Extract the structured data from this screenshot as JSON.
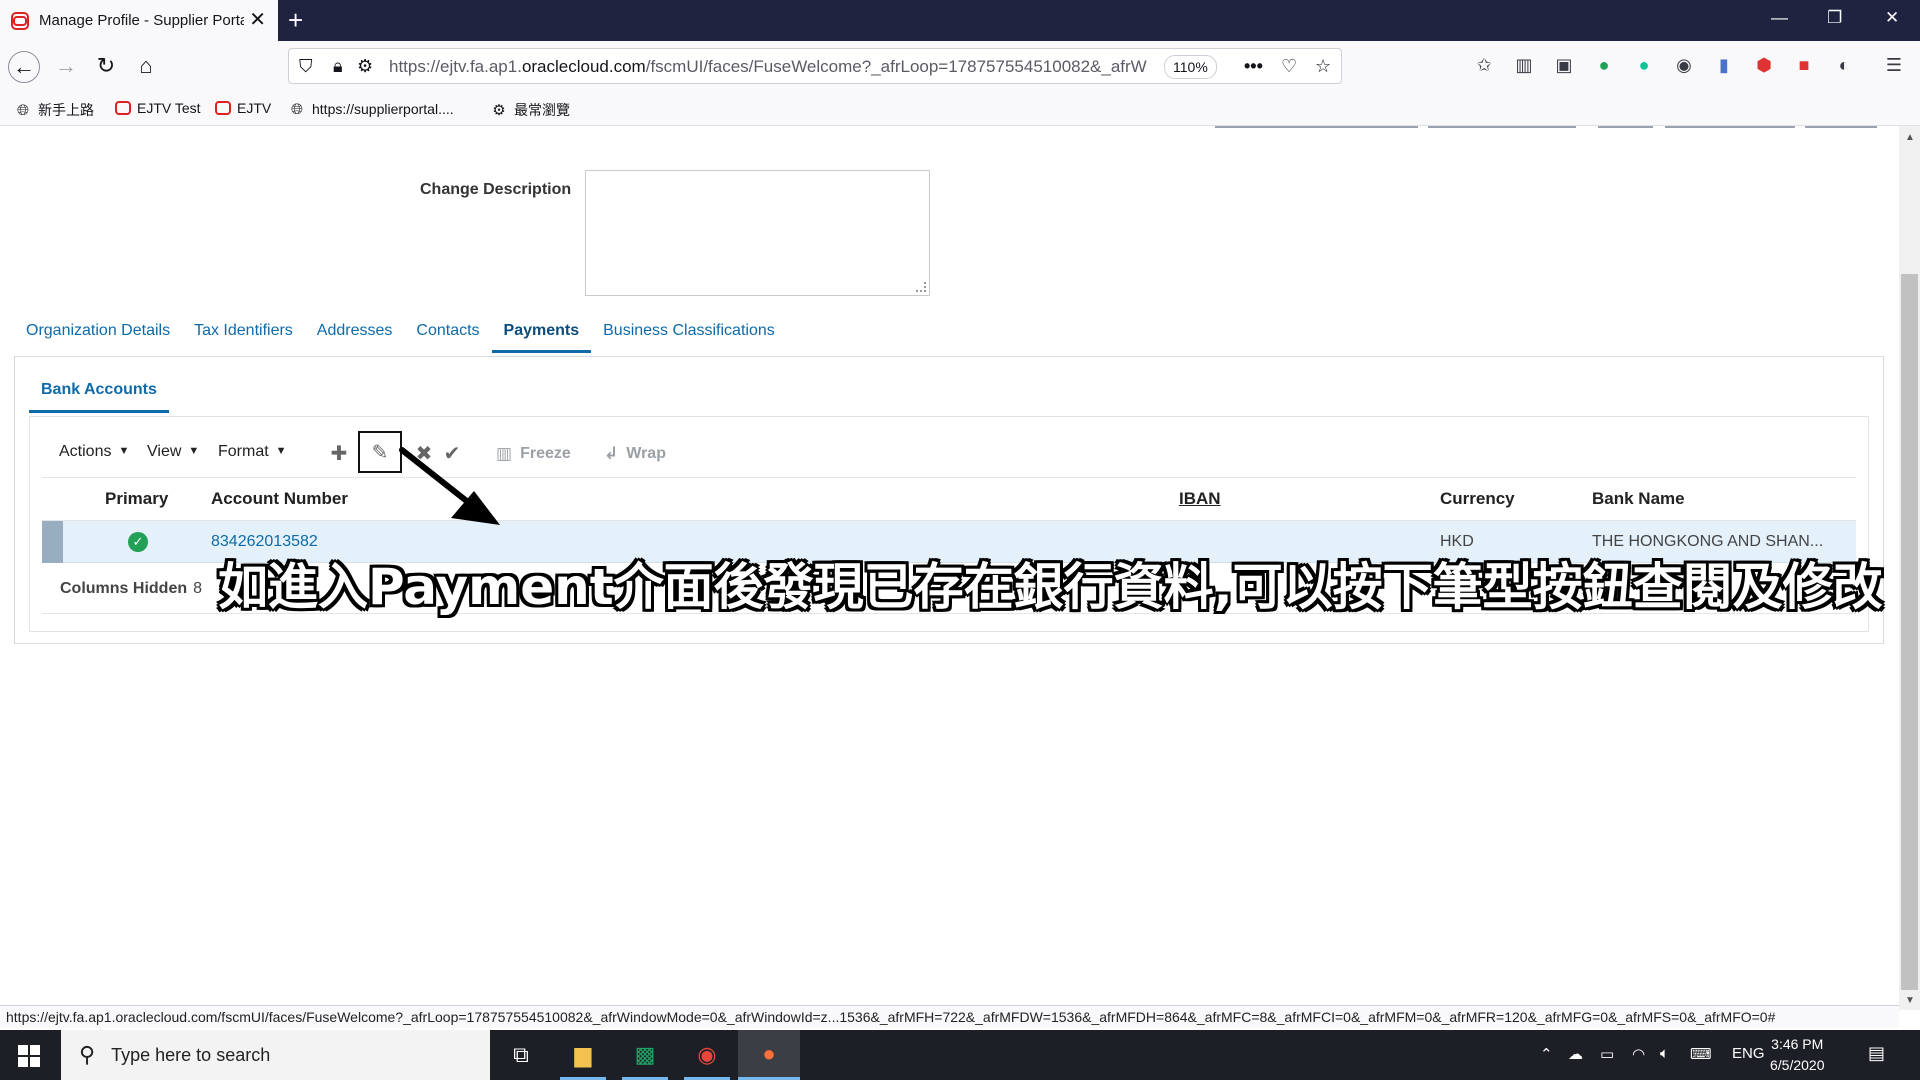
{
  "browser": {
    "tab_title": "Manage Profile - Supplier Portal",
    "url_prefix": "https://ejtv.fa.ap1.",
    "url_domain": "oraclecloud.com",
    "url_suffix": "/fscmUI/faces/FuseWelcome?_afrLoop=17875755451008​2&_afrW",
    "zoom": "110%",
    "bookmarks": [
      "新手上路",
      "EJTV Test",
      "EJTV",
      "https://supplierportal....",
      "最常瀏覽"
    ]
  },
  "form": {
    "change_description_label": "Change Description",
    "change_description_value": ""
  },
  "subtabs": [
    "Organization Details",
    "Tax Identifiers",
    "Addresses",
    "Contacts",
    "Payments",
    "Business Classifications"
  ],
  "active_subtab": "Payments",
  "bank": {
    "tab_label": "Bank Accounts",
    "menus": [
      "Actions",
      "View",
      "Format"
    ],
    "freeze_label": "Freeze",
    "wrap_label": "Wrap",
    "columns": {
      "primary": "Primary",
      "account_number": "Account Number",
      "iban": "IBAN",
      "currency": "Currency",
      "bank_name": "Bank Name"
    },
    "rows": [
      {
        "primary": true,
        "account_number": "834262013582",
        "iban": "",
        "currency": "HKD",
        "bank_name": "THE HONGKONG AND SHAN..."
      }
    ],
    "columns_hidden_label": "Columns Hidden",
    "columns_hidden_count": "8"
  },
  "annotation": {
    "caption": "如進入Payment介面後發現已存在銀行資料,可以按下筆型按鈕查閱及修改"
  },
  "status_url": "https://ejtv.fa.ap1.oraclecloud.com/fscmUI/faces/FuseWelcome?_afrLoop=17875755451008​2&_afrWindowMode=0&_afrWindowId=z...1536&_afrMFH=722&_afrMFDW=1536&_afrMFDH=864&_afrMFC=8&_afrMFCI=0&_afrMFM=0&_afrMFR=120&_afrMFG=0&_afrMFS=0&_afrMFO=0#",
  "taskbar": {
    "search_placeholder": "Type here to search",
    "language": "ENG",
    "time": "3:46 PM",
    "date": "6/5/2020"
  },
  "colors": {
    "link": "#0e6aa8",
    "selected_row": "#e4f0fa",
    "primary_check": "#21a056"
  }
}
